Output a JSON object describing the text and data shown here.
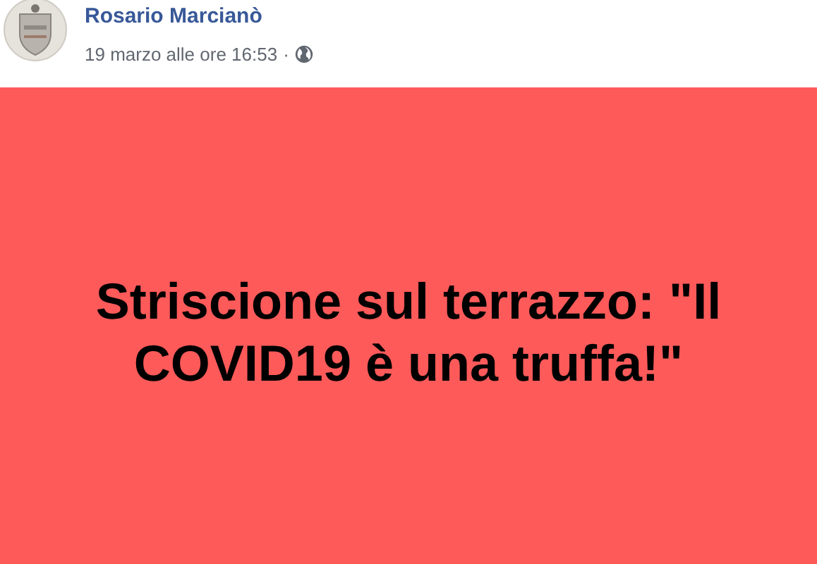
{
  "post": {
    "author": "Rosario Marcianò",
    "timestamp": "19 marzo alle ore 16:53",
    "separator": "·",
    "text": "Striscione sul terrazzo: \"Il COVID19 è una truffa!\""
  }
}
